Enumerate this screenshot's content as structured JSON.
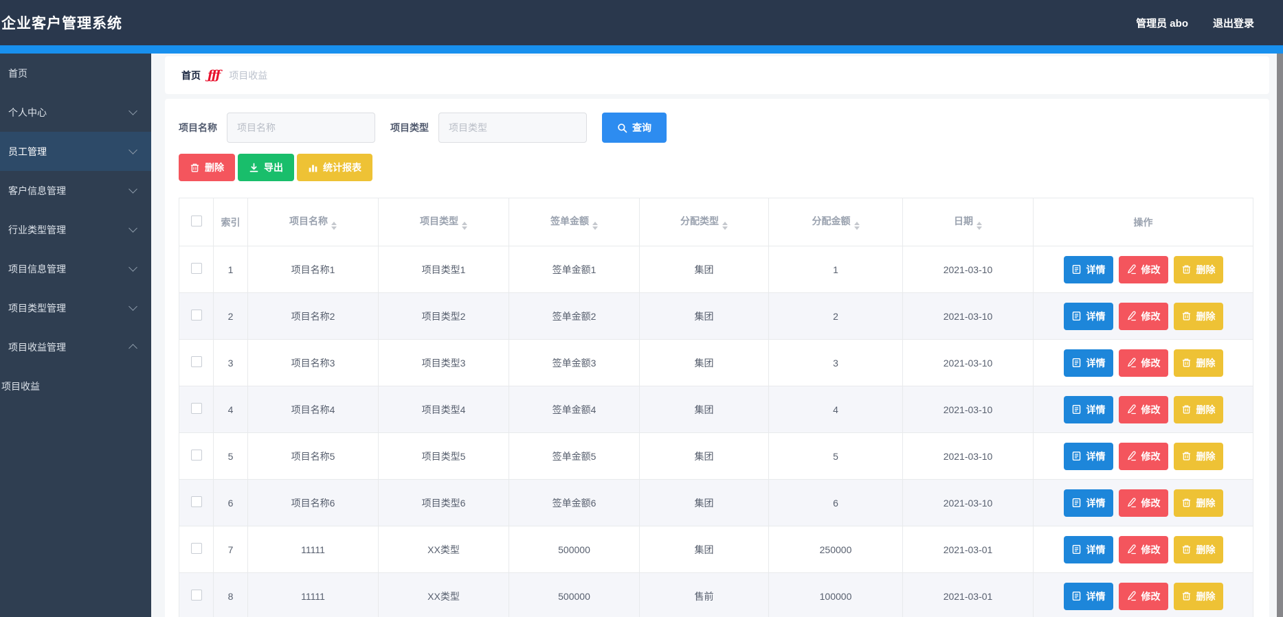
{
  "app": {
    "title": "企业客户管理系统"
  },
  "header": {
    "user": "管理员 abo",
    "logout": "退出登录"
  },
  "sidebar": {
    "items": [
      {
        "label": "首页",
        "chevron": "none",
        "selected": false,
        "submenu": false
      },
      {
        "label": "个人中心",
        "chevron": "down",
        "selected": false,
        "submenu": false
      },
      {
        "label": "员工管理",
        "chevron": "down",
        "selected": true,
        "submenu": false
      },
      {
        "label": "客户信息管理",
        "chevron": "down",
        "selected": false,
        "submenu": false
      },
      {
        "label": "行业类型管理",
        "chevron": "down",
        "selected": false,
        "submenu": false
      },
      {
        "label": "项目信息管理",
        "chevron": "down",
        "selected": false,
        "submenu": false
      },
      {
        "label": "项目类型管理",
        "chevron": "down",
        "selected": false,
        "submenu": false
      },
      {
        "label": "项目收益管理",
        "chevron": "up",
        "selected": false,
        "submenu": false
      },
      {
        "label": "项目收益",
        "chevron": "none",
        "selected": false,
        "submenu": true
      }
    ]
  },
  "breadcrumb": {
    "home": "首页",
    "separator": "ƒƒƒ",
    "current": "项目收益"
  },
  "filters": {
    "name_label": "项目名称",
    "name_placeholder": "项目名称",
    "name_value": "",
    "type_label": "项目类型",
    "type_placeholder": "项目类型",
    "type_value": "",
    "search_button": "查询"
  },
  "toolbar": {
    "delete_button": "删除",
    "export_button": "导出",
    "report_button": "统计报表"
  },
  "table": {
    "columns": [
      {
        "label": "",
        "sortable": false,
        "type": "checkbox"
      },
      {
        "label": "索引",
        "sortable": false,
        "type": "text"
      },
      {
        "label": "项目名称",
        "sortable": true,
        "type": "text"
      },
      {
        "label": "项目类型",
        "sortable": true,
        "type": "text"
      },
      {
        "label": "签单金额",
        "sortable": true,
        "type": "text"
      },
      {
        "label": "分配类型",
        "sortable": true,
        "type": "text"
      },
      {
        "label": "分配金额",
        "sortable": true,
        "type": "text"
      },
      {
        "label": "日期",
        "sortable": true,
        "type": "text"
      },
      {
        "label": "操作",
        "sortable": false,
        "type": "actions"
      }
    ],
    "row_actions": {
      "detail": "详情",
      "edit": "修改",
      "delete": "删除"
    },
    "rows": [
      {
        "index": "1",
        "name": "项目名称1",
        "type": "项目类型1",
        "sign_amount": "签单金额1",
        "alloc_type": "集团",
        "alloc_amount": "1",
        "date": "2021-03-10"
      },
      {
        "index": "2",
        "name": "项目名称2",
        "type": "项目类型2",
        "sign_amount": "签单金额2",
        "alloc_type": "集团",
        "alloc_amount": "2",
        "date": "2021-03-10"
      },
      {
        "index": "3",
        "name": "项目名称3",
        "type": "项目类型3",
        "sign_amount": "签单金额3",
        "alloc_type": "集团",
        "alloc_amount": "3",
        "date": "2021-03-10"
      },
      {
        "index": "4",
        "name": "项目名称4",
        "type": "项目类型4",
        "sign_amount": "签单金额4",
        "alloc_type": "集团",
        "alloc_amount": "4",
        "date": "2021-03-10"
      },
      {
        "index": "5",
        "name": "项目名称5",
        "type": "项目类型5",
        "sign_amount": "签单金额5",
        "alloc_type": "集团",
        "alloc_amount": "5",
        "date": "2021-03-10"
      },
      {
        "index": "6",
        "name": "项目名称6",
        "type": "项目类型6",
        "sign_amount": "签单金额6",
        "alloc_type": "集团",
        "alloc_amount": "6",
        "date": "2021-03-10"
      },
      {
        "index": "7",
        "name": "11111",
        "type": "XX类型",
        "sign_amount": "500000",
        "alloc_type": "集团",
        "alloc_amount": "250000",
        "date": "2021-03-01"
      },
      {
        "index": "8",
        "name": "11111",
        "type": "XX类型",
        "sign_amount": "500000",
        "alloc_type": "售前",
        "alloc_amount": "100000",
        "date": "2021-03-01"
      }
    ]
  },
  "colors": {
    "header_bg": "#2a384d",
    "sidebar_bg": "#2f3e51",
    "sidebar_selected": "#2d4a68",
    "accent_blue": "#1890ee",
    "primary_button": "#2d8cf0",
    "detail_button": "#1d86da",
    "danger": "#f4555d",
    "success": "#19be6b",
    "warning": "#eec235"
  }
}
